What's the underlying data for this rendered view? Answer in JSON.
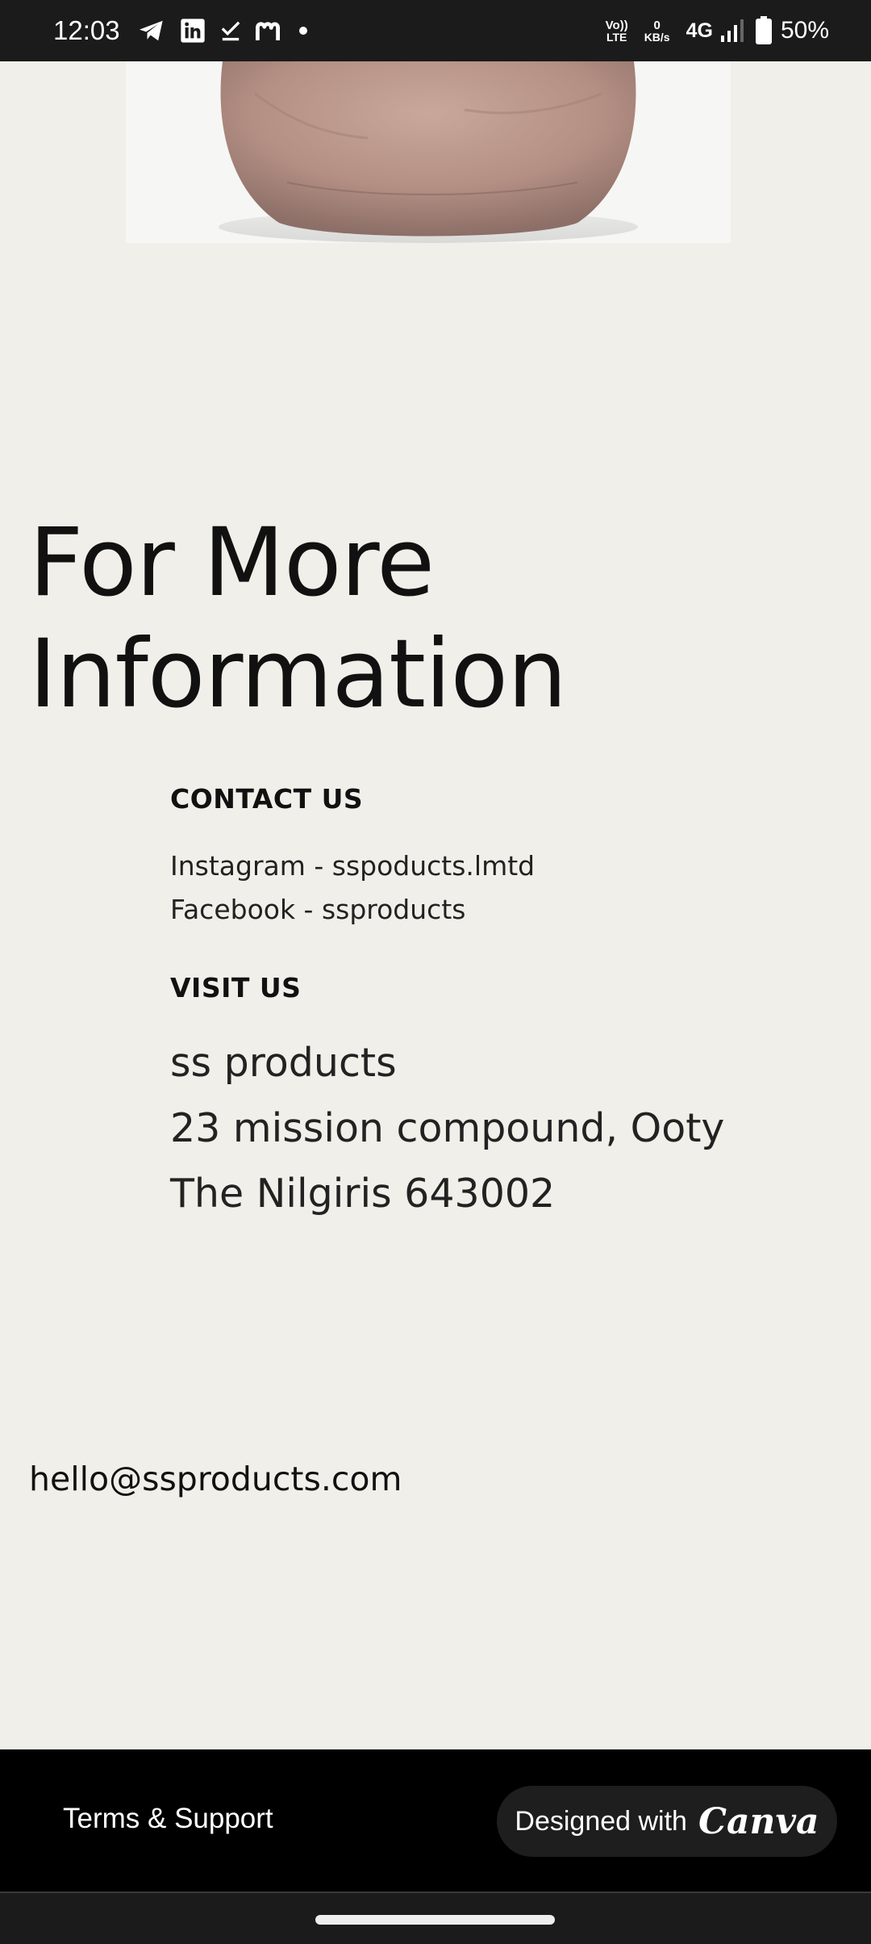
{
  "status_bar": {
    "time": "12:03",
    "left_icons": [
      "telegram-icon",
      "linkedin-icon",
      "checkmark-icon",
      "medium-icon",
      "notification-dot"
    ],
    "volte": "Vo))",
    "lte": "LTE",
    "speed_value": "0",
    "speed_unit": "KB/s",
    "network": "4G",
    "battery": "50%"
  },
  "product_image": {
    "alt_icon": "clay-pot-image"
  },
  "info": {
    "heading_line1": "For More",
    "heading_line2": "Information",
    "contact_label": "CONTACT US",
    "contact_instagram": "Instagram - sspoducts.lmtd",
    "contact_facebook": "Facebook - ssproducts",
    "visit_label": "VISIT US",
    "visit_name": "ss products",
    "visit_street": "23 mission compound, Ooty",
    "visit_city": "The Nilgiris 643002",
    "email": "hello@ssproducts.com"
  },
  "footer": {
    "terms": "Terms & Support",
    "designed_with": "Designed with",
    "brand": "Canva"
  }
}
